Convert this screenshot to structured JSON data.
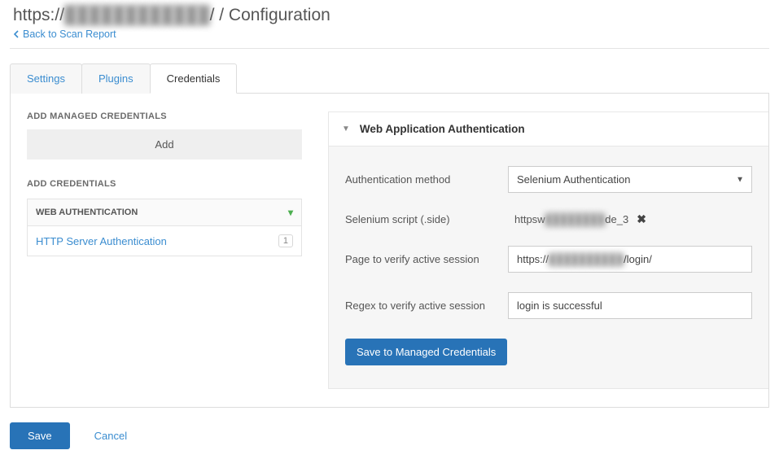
{
  "header": {
    "title_prefix": "https://",
    "title_mid_blur": "████████████",
    "title_suffix": "/ / Configuration",
    "back_label": "Back to Scan Report"
  },
  "tabs": {
    "settings": "Settings",
    "plugins": "Plugins",
    "credentials": "Credentials"
  },
  "left": {
    "add_managed_caption": "ADD MANAGED CREDENTIALS",
    "add_button_label": "Add",
    "add_creds_caption": "ADD CREDENTIALS",
    "category_label": "WEB AUTHENTICATION",
    "item_label": "HTTP Server Authentication",
    "item_count": "1"
  },
  "form": {
    "heading": "Web Application Authentication",
    "fields": {
      "auth_method_label": "Authentication method",
      "auth_method_value": "Selenium Authentication",
      "script_label": "Selenium script (.side)",
      "script_value_prefix": "httpsw",
      "script_value_blur": "████████",
      "script_value_suffix": "de_3",
      "verify_page_label": "Page to verify active session",
      "verify_page_value_prefix": "https://",
      "verify_page_value_blur": "██████████",
      "verify_page_value_suffix": "/login/",
      "regex_label": "Regex to verify active session",
      "regex_value": "login is successful"
    },
    "save_managed_label": "Save to Managed Credentials"
  },
  "footer": {
    "save_label": "Save",
    "cancel_label": "Cancel"
  }
}
